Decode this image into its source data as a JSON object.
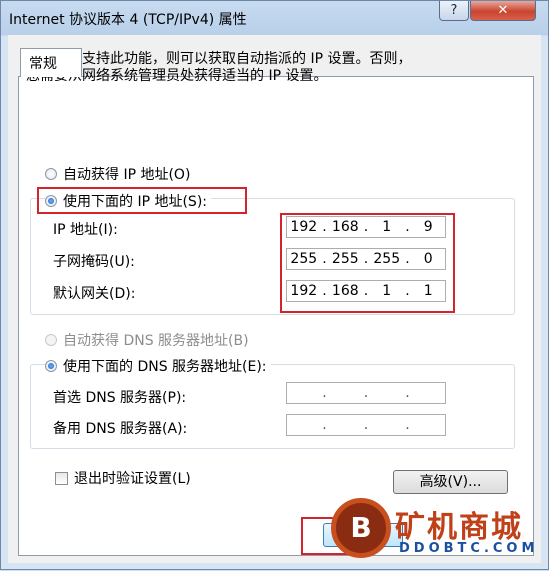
{
  "window": {
    "title": "Internet 协议版本 4 (TCP/IPv4) 属性",
    "help_label": "?",
    "close_label": "✕"
  },
  "tabs": [
    {
      "label": "常规"
    }
  ],
  "description": {
    "line1": "如果网络支持此功能，则可以获取自动指派的 IP 设置。否则，",
    "line2": "您需要从网络系统管理员处获得适当的 IP 设置。"
  },
  "ip_section": {
    "auto_label": "自动获得 IP 地址(O)",
    "manual_label": "使用下面的 IP 地址(S):",
    "selected": "manual",
    "fields": [
      {
        "label": "IP 地址(I):",
        "octets": [
          "192",
          "168",
          "1",
          "9"
        ]
      },
      {
        "label": "子网掩码(U):",
        "octets": [
          "255",
          "255",
          "255",
          "0"
        ]
      },
      {
        "label": "默认网关(D):",
        "octets": [
          "192",
          "168",
          "1",
          "1"
        ]
      }
    ]
  },
  "dns_section": {
    "auto_label": "自动获得 DNS 服务器地址(B)",
    "manual_label": "使用下面的 DNS 服务器地址(E):",
    "selected": "manual",
    "fields": [
      {
        "label": "首选 DNS 服务器(P):",
        "octets": [
          "",
          "",
          "",
          ""
        ]
      },
      {
        "label": "备用 DNS 服务器(A):",
        "octets": [
          "",
          "",
          "",
          ""
        ]
      }
    ]
  },
  "validate_checkbox": {
    "label": "退出时验证设置(L)",
    "checked": false
  },
  "advanced_button": {
    "label": "高级(V)..."
  },
  "watermark": {
    "logo": "B",
    "title": "矿机商城",
    "subtitle": "DDOBTC.COM"
  },
  "colors": {
    "highlight": "#d4232a",
    "accent": "#1c5fb8"
  }
}
